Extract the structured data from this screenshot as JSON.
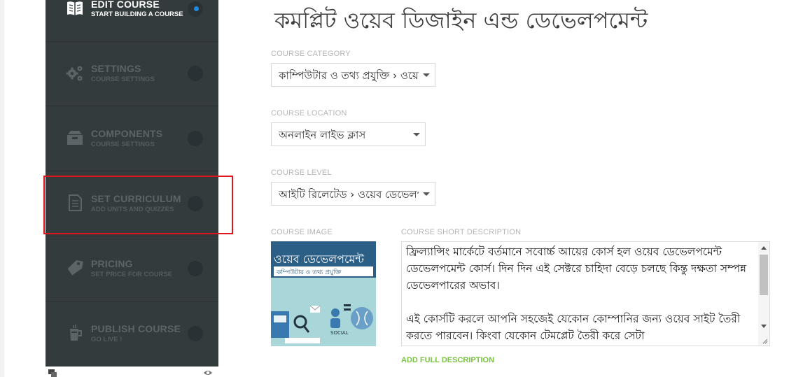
{
  "sidebar": {
    "steps": [
      {
        "title": "EDIT COURSE",
        "subtitle": "START BUILDING A COURSE",
        "icon": "book-icon",
        "active": true
      },
      {
        "title": "SETTINGS",
        "subtitle": "COURSE SETTINGS",
        "icon": "gears-icon",
        "active": false
      },
      {
        "title": "COMPONENTS",
        "subtitle": "COURSE SETTINGS",
        "icon": "archive-icon",
        "active": false
      },
      {
        "title": "SET CURRICULUM",
        "subtitle": "ADD UNITS AND QUIZZES",
        "icon": "document-icon",
        "active": false
      },
      {
        "title": "PRICING",
        "subtitle": "SET PRICE FOR COURSE",
        "icon": "tag-icon",
        "active": false
      },
      {
        "title": "PUBLISH COURSE",
        "subtitle": "GO LIVE !",
        "icon": "glass-icon",
        "active": false
      }
    ],
    "active_dot_color": "#1e88e5",
    "highlight_color": "#e0141b"
  },
  "main": {
    "title": "কমপ্লিট ওয়েব ডিজাইন এন্ড ডেভেলপমেন্ট",
    "category": {
      "label": "COURSE CATEGORY",
      "value": "কাম্পিউটার ও তথ্য প্রযুক্তি › ওয়েব"
    },
    "location": {
      "label": "COURSE LOCATION",
      "value": "অনলাইন লাইভ ক্লাস"
    },
    "level": {
      "label": "COURSE LEVEL",
      "value": "আইটি রিলেটেড › ওয়েব ডেভেলপমেন্ট"
    },
    "image": {
      "label": "COURSE IMAGE",
      "line1": "ওয়েব ডেভেলপমেন্ট",
      "line2": "কম্পিউটার ও তথ্য প্রযুক্তি",
      "badge": "SOCIAL"
    },
    "description": {
      "label": "COURSE SHORT DESCRIPTION",
      "text": "ফ্রিল্যান্সিং মার্কেটে বর্তমানে সবোর্চ্চ আয়ের কোর্স হল ওয়েব ডেভেলপমেন্ট ডেভেলপমেন্ট কোর্স। দিন দিন এই সেক্টরে চাহিদা বেড়ে চলছে কিন্তু দক্ষতা সম্পন্ন ডেভেলপারের অভাব।\n\nএই কোর্সটি করলে আপনি সহজেই যেকোন কোম্পানির জন্য ওয়েব সাইট তৈরী করতে পারবেন। কিংবা যেকোন টেমপ্লেট তৈরী করে সেটা"
    },
    "add_full_description": "ADD FULL DESCRIPTION",
    "link_color": "#7ac142"
  }
}
